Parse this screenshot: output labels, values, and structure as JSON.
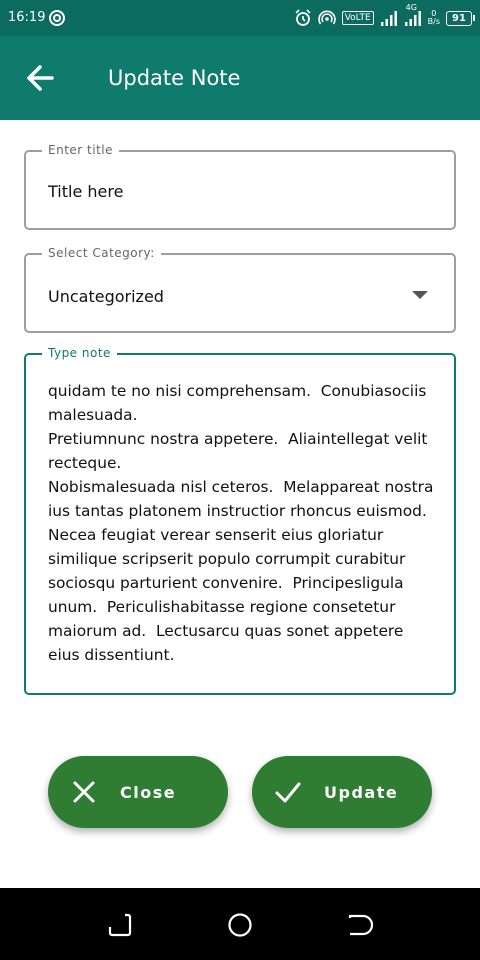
{
  "status_bar": {
    "time": "16:19",
    "volte": "VoLTE",
    "network": "4G",
    "speed_value": "0",
    "speed_unit": "B/s",
    "battery": "91"
  },
  "app_bar": {
    "title": "Update Note",
    "back_icon": "arrow-back-icon"
  },
  "form": {
    "title_label": "Enter title",
    "title_value": "Title here",
    "category_label": "Select Category:",
    "category_value": "Uncategorized",
    "note_label": "Type note",
    "note_value": "quidam te no nisi comprehensam.  Conubiasociis malesuada.\nPretiumnunc nostra appetere.  Aliaintellegat velit recteque.\nNobismalesuada nisl ceteros.  Melappareat nostra ius tantas platonem instructior rhoncus euismod. Necea feugiat verear senserit eius gloriatur similique scripserit populo corrumpit curabitur sociosqu parturient convenire.  Principesligula unum.  Periculishabitasse regione consetetur maiorum ad.  Lectusarcu quas sonet appetere eius dissentiunt."
  },
  "actions": {
    "close_label": "Close",
    "update_label": "Update"
  },
  "colors": {
    "status_bar": "#0b6b5e",
    "app_bar": "#0e7b6c",
    "button": "#2e7d32",
    "note_outline": "#0e7b6c"
  }
}
